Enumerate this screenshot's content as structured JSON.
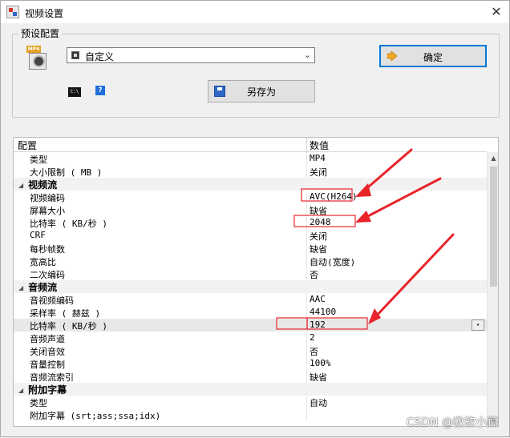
{
  "window": {
    "title": "视频设置",
    "close_glyph": "✕"
  },
  "preset": {
    "group_label": "预设配置",
    "selected": "自定义",
    "ok_label": "确定",
    "save_as_label": "另存为",
    "mp4_tag": "MP4",
    "cmd_glyph": "C:\\"
  },
  "grid": {
    "col_name": "配置",
    "col_value": "数值",
    "rows": [
      {
        "type": "item",
        "name": "类型",
        "value": "MP4"
      },
      {
        "type": "item",
        "name": "大小限制 ( MB )",
        "value": "关闭"
      },
      {
        "type": "cat",
        "name": "视频流"
      },
      {
        "type": "item",
        "name": "视频编码",
        "value": "AVC(H264)"
      },
      {
        "type": "item",
        "name": "屏幕大小",
        "value": "缺省"
      },
      {
        "type": "item",
        "name": "比特率 ( KB/秒 )",
        "value": "2048"
      },
      {
        "type": "item",
        "name": "CRF",
        "value": "关闭"
      },
      {
        "type": "item",
        "name": "每秒帧数",
        "value": "缺省"
      },
      {
        "type": "item",
        "name": "宽高比",
        "value": "自动(宽度)"
      },
      {
        "type": "item",
        "name": "二次编码",
        "value": "否"
      },
      {
        "type": "cat",
        "name": "音频流"
      },
      {
        "type": "item",
        "name": "音视频编码",
        "value": "AAC"
      },
      {
        "type": "item",
        "name": "采样率 ( 赫兹 )",
        "value": "44100"
      },
      {
        "type": "item",
        "name": "比特率 ( KB/秒 )",
        "value": "192",
        "selected": true
      },
      {
        "type": "item",
        "name": "音频声道",
        "value": "2"
      },
      {
        "type": "item",
        "name": "关闭音效",
        "value": "否"
      },
      {
        "type": "item",
        "name": "音量控制",
        "value": "100%"
      },
      {
        "type": "item",
        "name": "音频流索引",
        "value": "缺省"
      },
      {
        "type": "cat",
        "name": "附加字幕"
      },
      {
        "type": "item",
        "name": "类型",
        "value": "自动"
      },
      {
        "type": "item",
        "name": "附加字幕 (srt;ass;ssa;idx)",
        "value": ""
      }
    ]
  },
  "annotation_color": "#e8242a",
  "watermark": "CSDN @教软小顾"
}
